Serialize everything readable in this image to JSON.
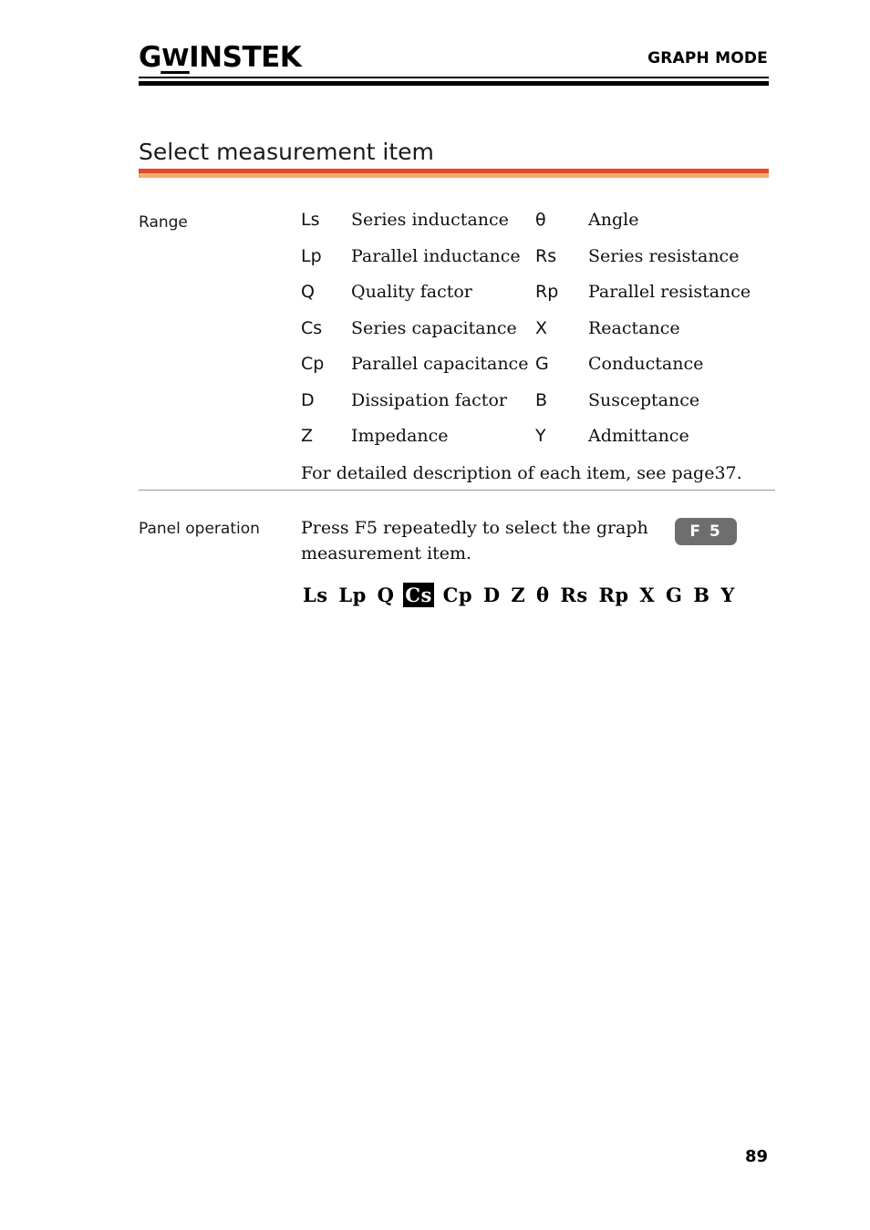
{
  "header": {
    "logo_g": "G",
    "logo_w": "W",
    "logo_instek": "INSTEK",
    "title": "GRAPH MODE"
  },
  "section": {
    "title": "Select measurement item"
  },
  "range": {
    "label": "Range",
    "rows": [
      {
        "sym": "Ls",
        "desc": "Series inductance",
        "sym2": "θ",
        "desc2": "Angle"
      },
      {
        "sym": "Lp",
        "desc": "Parallel inductance",
        "sym2": "Rs",
        "desc2": "Series resistance"
      },
      {
        "sym": "Q",
        "desc": "Quality factor",
        "sym2": "Rp",
        "desc2": "Parallel resistance"
      },
      {
        "sym": "Cs",
        "desc": "Series capacitance",
        "sym2": "X",
        "desc2": "Reactance"
      },
      {
        "sym": "Cp",
        "desc": "Parallel capacitance",
        "sym2": "G",
        "desc2": "Conductance"
      },
      {
        "sym": "D",
        "desc": "Dissipation factor",
        "sym2": "B",
        "desc2": "Susceptance"
      },
      {
        "sym": "Z",
        "desc": "Impedance",
        "sym2": "Y",
        "desc2": "Admittance"
      }
    ],
    "note": "For detailed description of each item, see page37."
  },
  "panel_operation": {
    "label": "Panel operation",
    "instruction": "Press F5 repeatedly to select the graph measurement item.",
    "fkey_label": "F 5",
    "sequence": [
      {
        "text": "Ls",
        "selected": false
      },
      {
        "text": "Lp",
        "selected": false
      },
      {
        "text": "Q",
        "selected": false
      },
      {
        "text": "Cs",
        "selected": true
      },
      {
        "text": "Cp",
        "selected": false
      },
      {
        "text": "D",
        "selected": false
      },
      {
        "text": "Z",
        "selected": false
      },
      {
        "text": "θ",
        "selected": false
      },
      {
        "text": "Rs",
        "selected": false
      },
      {
        "text": "Rp",
        "selected": false
      },
      {
        "text": "X",
        "selected": false
      },
      {
        "text": "G",
        "selected": false
      },
      {
        "text": "B",
        "selected": false
      },
      {
        "text": "Y",
        "selected": false
      }
    ]
  },
  "footer": {
    "page_number": "89"
  },
  "colors": {
    "rule_orange_dark": "#E0492A",
    "rule_orange_light": "#F3AC6A",
    "fkey_badge": "#6E6E6E",
    "divider": "#9A9A9A"
  }
}
